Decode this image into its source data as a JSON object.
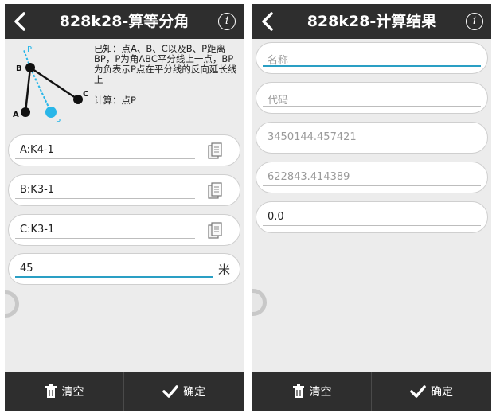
{
  "left": {
    "title": "828k28-算等分角",
    "description": "已知：点A、B、C以及B、P距离BP，P为角ABC平分线上一点，BP为负表示P点在平分线的反向延长线上",
    "description_cut": "计算：点P",
    "diagram_labels": {
      "p_prime": "P'",
      "b": "B",
      "a": "A",
      "c": "C",
      "p": "P"
    },
    "fields": [
      {
        "value": "A:K4-1",
        "icon": "copy-icon"
      },
      {
        "value": "B:K3-1",
        "icon": "copy-icon"
      },
      {
        "value": "C:K3-1",
        "icon": "copy-icon"
      }
    ],
    "distance": {
      "value": "45",
      "unit": "米"
    },
    "clear_label": "清空",
    "confirm_label": "确定"
  },
  "right": {
    "title": "828k28-计算结果",
    "fields": [
      {
        "placeholder": "名称",
        "value": ""
      },
      {
        "placeholder": "代码",
        "value": ""
      },
      {
        "placeholder": "3450144.457421",
        "value": ""
      },
      {
        "placeholder": "622843.414389",
        "value": ""
      },
      {
        "placeholder": "",
        "value": "0.0"
      }
    ],
    "clear_label": "清空",
    "confirm_label": "确定"
  },
  "colors": {
    "bar": "#2e2e2e",
    "background": "#ececec",
    "accent": "#2a9fc4",
    "point_p": "#29b6e8"
  }
}
